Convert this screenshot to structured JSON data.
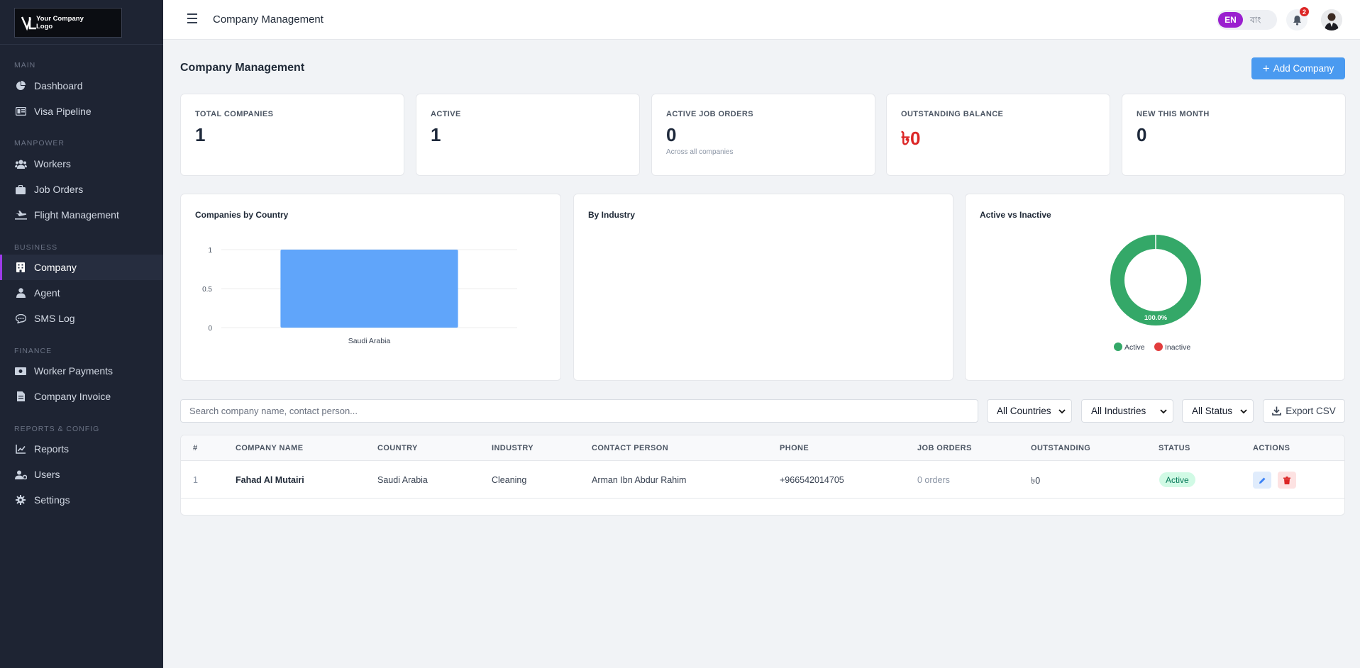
{
  "app": {
    "logo_text_line1": "Your Company",
    "logo_text_line2": "Logo",
    "title": "Company Management"
  },
  "sidebar": {
    "sections": [
      {
        "label": "MAIN",
        "items": [
          {
            "label": "Dashboard",
            "icon": "chart-pie-icon"
          },
          {
            "label": "Visa Pipeline",
            "icon": "id-card-icon"
          }
        ]
      },
      {
        "label": "MANPOWER",
        "items": [
          {
            "label": "Workers",
            "icon": "users-icon"
          },
          {
            "label": "Job Orders",
            "icon": "briefcase-icon"
          },
          {
            "label": "Flight Management",
            "icon": "plane-icon"
          }
        ]
      },
      {
        "label": "BUSINESS",
        "items": [
          {
            "label": "Company",
            "icon": "building-icon",
            "active": true
          },
          {
            "label": "Agent",
            "icon": "user-tie-icon"
          },
          {
            "label": "SMS Log",
            "icon": "sms-icon"
          }
        ]
      },
      {
        "label": "FINANCE",
        "items": [
          {
            "label": "Worker Payments",
            "icon": "money-icon"
          },
          {
            "label": "Company Invoice",
            "icon": "invoice-icon"
          }
        ]
      },
      {
        "label": "REPORTS & CONFIG",
        "items": [
          {
            "label": "Reports",
            "icon": "chart-line-icon"
          },
          {
            "label": "Users",
            "icon": "users-cog-icon"
          },
          {
            "label": "Settings",
            "icon": "gear-icon"
          }
        ]
      }
    ]
  },
  "topbar": {
    "lang_en": "EN",
    "lang_bn": "বাং",
    "notification_count": "2"
  },
  "main": {
    "page_title": "Company Management",
    "add_button": "Add Company",
    "stats": [
      {
        "label": "TOTAL COMPANIES",
        "value": "1",
        "sub": ""
      },
      {
        "label": "ACTIVE",
        "value": "1",
        "sub": ""
      },
      {
        "label": "ACTIVE JOB ORDERS",
        "value": "0",
        "sub": "Across all companies"
      },
      {
        "label": "OUTSTANDING BALANCE",
        "value": "৳0",
        "sub": "",
        "color": "#dc2626"
      },
      {
        "label": "NEW THIS MONTH",
        "value": "0",
        "sub": ""
      }
    ],
    "filters": {
      "search_placeholder": "Search company name, contact person...",
      "country": "All Countries",
      "industry": "All Industries",
      "status": "All Status",
      "export": "Export CSV"
    },
    "table": {
      "headers": [
        "#",
        "COMPANY NAME",
        "COUNTRY",
        "INDUSTRY",
        "CONTACT PERSON",
        "PHONE",
        "JOB ORDERS",
        "OUTSTANDING",
        "STATUS",
        "ACTIONS"
      ],
      "rows": [
        {
          "num": "1",
          "company": "Fahad Al Mutairi",
          "country": "Saudi Arabia",
          "industry": "Cleaning",
          "contact": "Arman Ibn Abdur Rahim",
          "phone": "+966542014705",
          "job_orders": "0 orders",
          "outstanding": "৳0",
          "status": "Active"
        }
      ]
    }
  },
  "chart_data": [
    {
      "type": "bar",
      "title": "Companies by Country",
      "categories": [
        "Saudi Arabia"
      ],
      "values": [
        1
      ],
      "ylim": [
        0,
        1
      ],
      "yticks": [
        "0",
        "0.5",
        "1"
      ],
      "color": "#60a5fa",
      "grid": true
    },
    {
      "type": "bar",
      "title": "By Industry",
      "categories": [],
      "values": []
    },
    {
      "type": "pie",
      "title": "Active vs Inactive",
      "categories": [
        "Active",
        "Inactive"
      ],
      "values": [
        1,
        0
      ],
      "colors": [
        "#34a868",
        "#e23d3d"
      ],
      "data_label": "100.0%",
      "legend": "bottom"
    }
  ]
}
